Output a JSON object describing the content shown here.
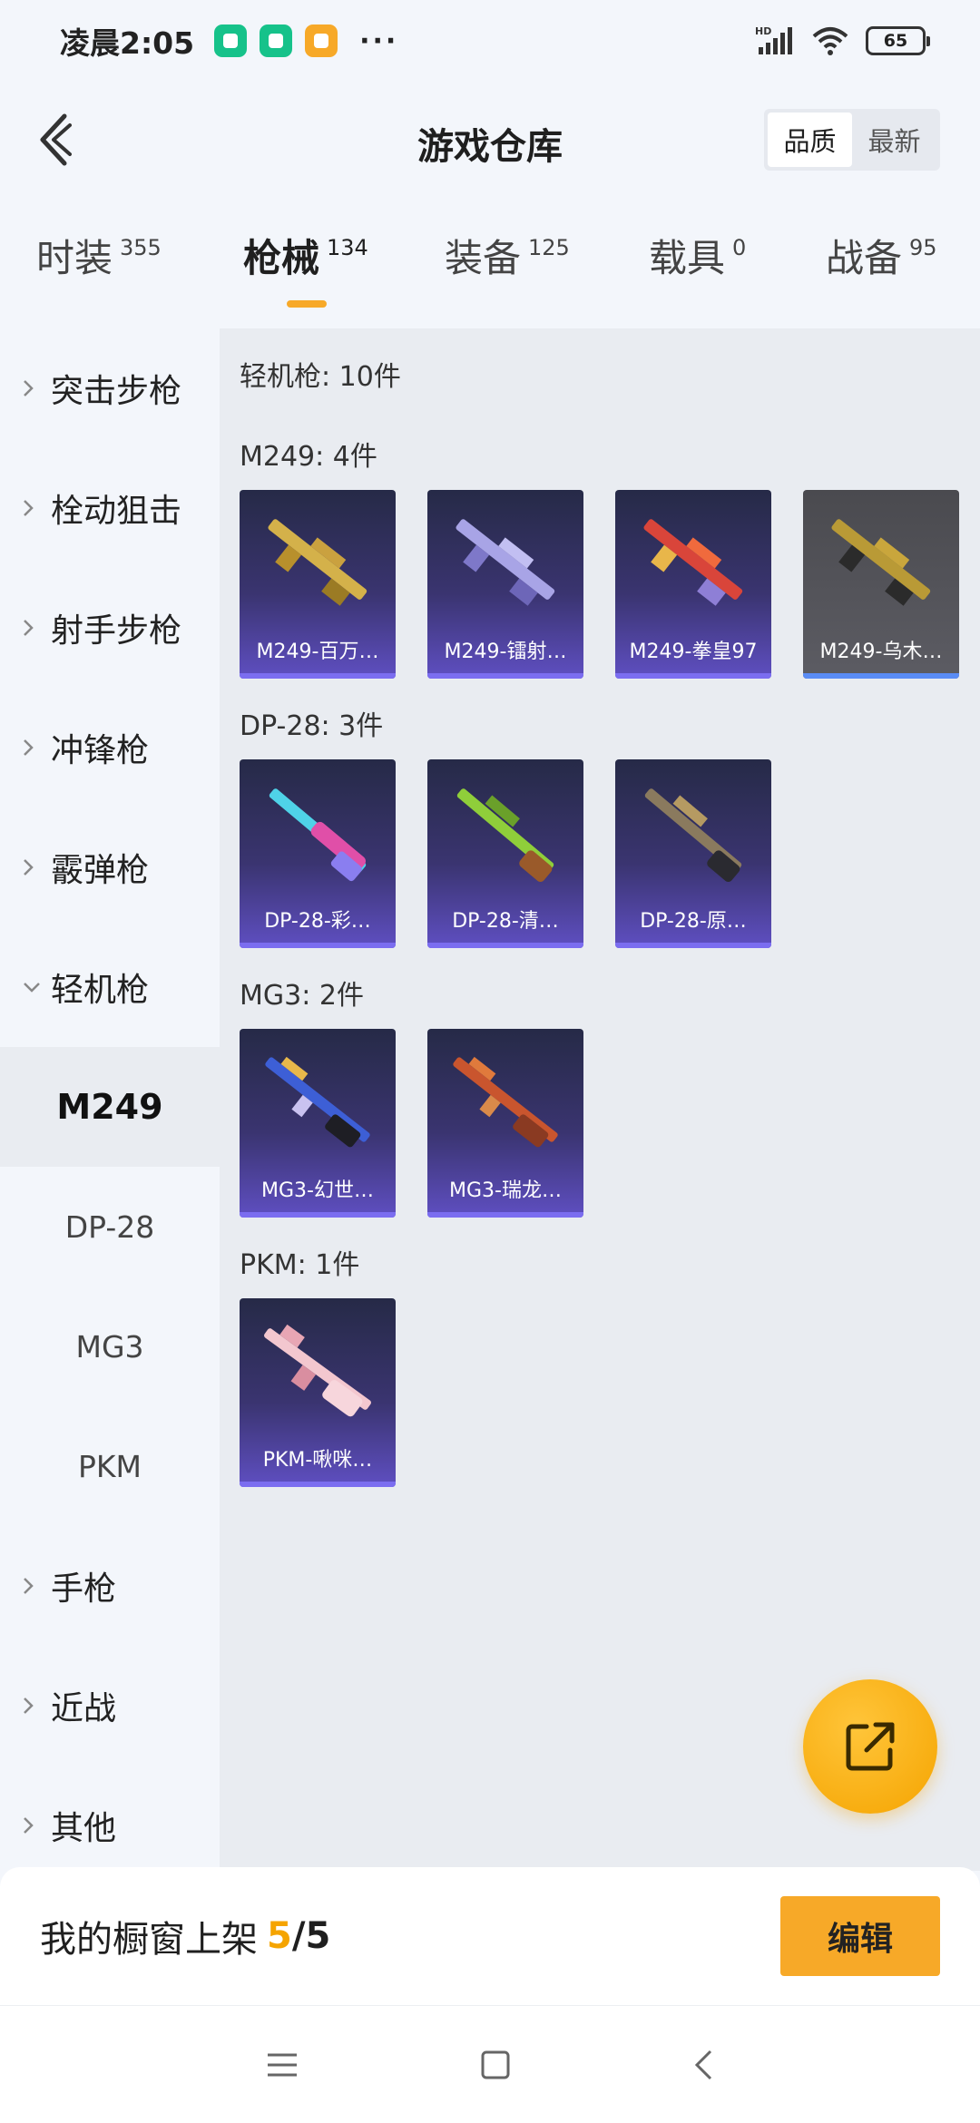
{
  "status_bar": {
    "time": "凌晨2:05",
    "dots": "···",
    "signal": "HD",
    "battery": "65"
  },
  "header": {
    "title": "游戏仓库",
    "sort_options": [
      "品质",
      "最新"
    ],
    "active_sort": "品质"
  },
  "category_tabs": [
    {
      "label": "时装",
      "count": "355"
    },
    {
      "label": "枪械",
      "count": "134",
      "active": true
    },
    {
      "label": "装备",
      "count": "125"
    },
    {
      "label": "载具",
      "count": "0"
    },
    {
      "label": "战备",
      "count": "95"
    }
  ],
  "sidebar": {
    "items": [
      {
        "label": "突击步枪"
      },
      {
        "label": "栓动狙击"
      },
      {
        "label": "射手步枪"
      },
      {
        "label": "冲锋枪"
      },
      {
        "label": "霰弹枪"
      },
      {
        "label": "轻机枪",
        "expanded": true
      }
    ],
    "subitems": [
      {
        "label": "M249",
        "active": true
      },
      {
        "label": "DP-28"
      },
      {
        "label": "MG3"
      },
      {
        "label": "PKM"
      }
    ],
    "items_after": [
      {
        "label": "手枪"
      },
      {
        "label": "近战"
      },
      {
        "label": "其他"
      }
    ]
  },
  "content": {
    "category_summary": "轻机枪: 10件",
    "groups": [
      {
        "title": "M249: 4件",
        "items": [
          "M249-百万…",
          "M249-镭射…",
          "M249-拳皇97",
          "M249-乌木…"
        ]
      },
      {
        "title": "DP-28: 3件",
        "items": [
          "DP-28-彩…",
          "DP-28-清…",
          "DP-28-原…"
        ]
      },
      {
        "title": "MG3: 2件",
        "items": [
          "MG3-幻世…",
          "MG3-瑞龙…"
        ]
      },
      {
        "title": "PKM: 1件",
        "items": [
          "PKM-啾咪…"
        ]
      }
    ]
  },
  "bottom_bar": {
    "label": "我的橱窗上架",
    "count": "5",
    "total": "/5",
    "edit_label": "编辑"
  },
  "colors": {
    "accent": "#f7a928",
    "card_bar": "#7b6df0"
  }
}
